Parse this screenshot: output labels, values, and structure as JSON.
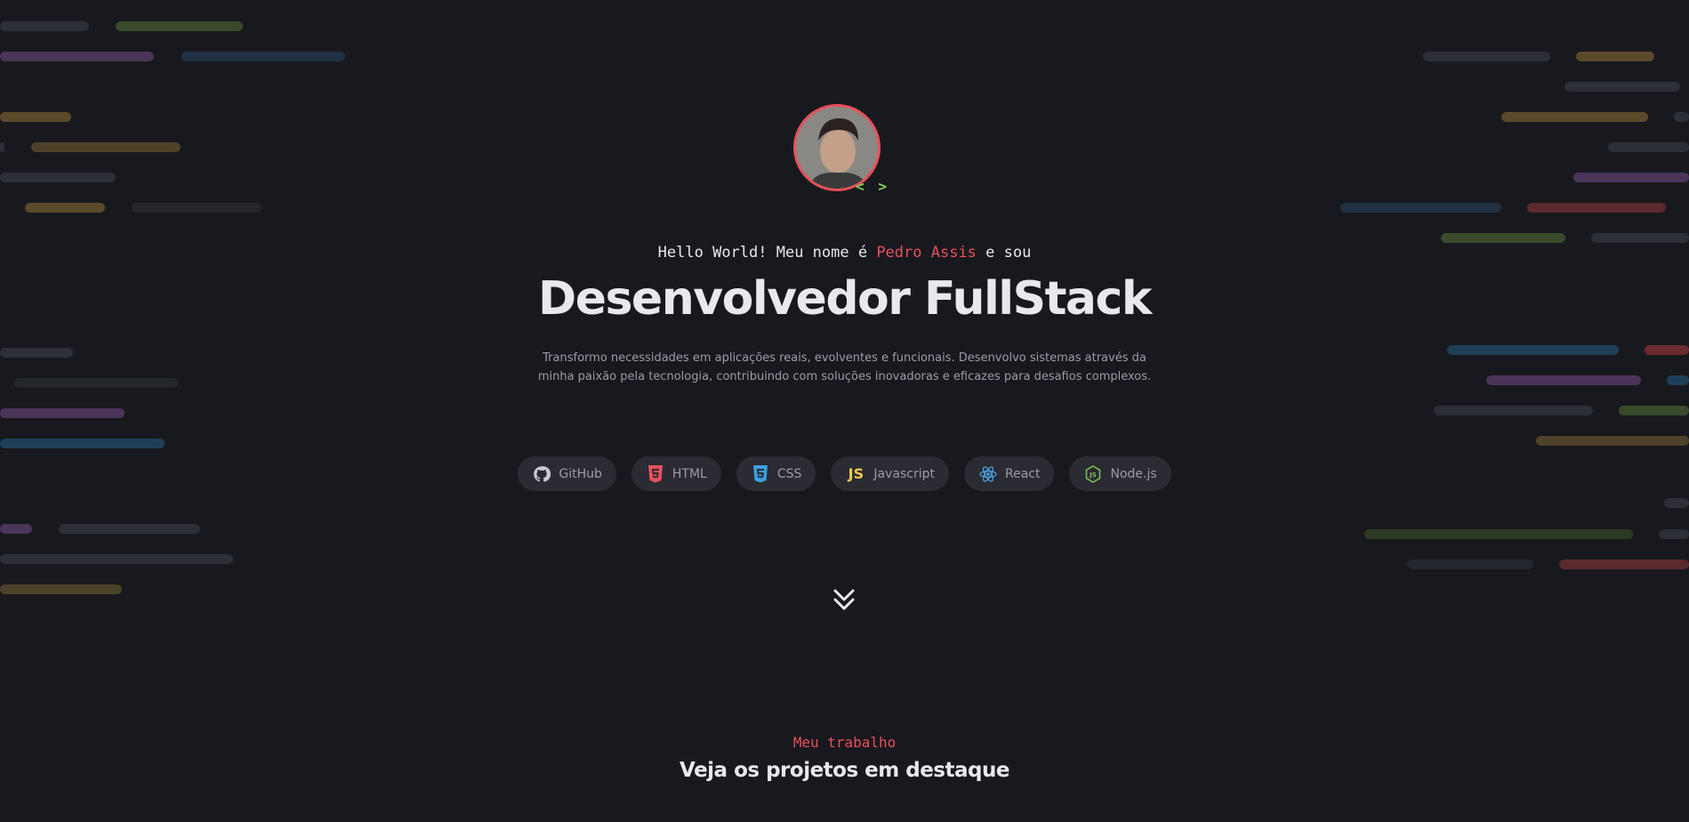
{
  "hero": {
    "greeting_prefix": "Hello World! Meu nome é ",
    "name": "Pedro Assis",
    "greeting_suffix": " e sou",
    "title": "Desenvolvedor FullStack",
    "description_line1": "Transformo necessidades em aplicações reais, evolventes e funcionais. Desenvolvo sistemas através da",
    "description_line2": "minha paixão pela tecnologia, contribuindo com soluções inovadoras e eficazes para desafios complexos.",
    "code_badge": "< >"
  },
  "chips": [
    {
      "label": "GitHub",
      "icon": "github-icon"
    },
    {
      "label": "HTML",
      "icon": "html5-icon"
    },
    {
      "label": "CSS",
      "icon": "css3-icon"
    },
    {
      "label": "Javascript",
      "icon": "js-icon",
      "icon_text": "JS"
    },
    {
      "label": "React",
      "icon": "react-icon"
    },
    {
      "label": "Node.js",
      "icon": "nodejs-icon"
    }
  ],
  "scroll": {
    "icon": "double-chevron-down-icon"
  },
  "projects_section": {
    "label": "Meu trabalho",
    "title": "Veja os projetos em destaque"
  },
  "colors": {
    "background": "#18191e",
    "accent": "#e8505b",
    "chip_bg": "#2a2b33",
    "text": "#e8e8ef",
    "muted": "#9a9caa",
    "code_green": "#7bd35a"
  }
}
